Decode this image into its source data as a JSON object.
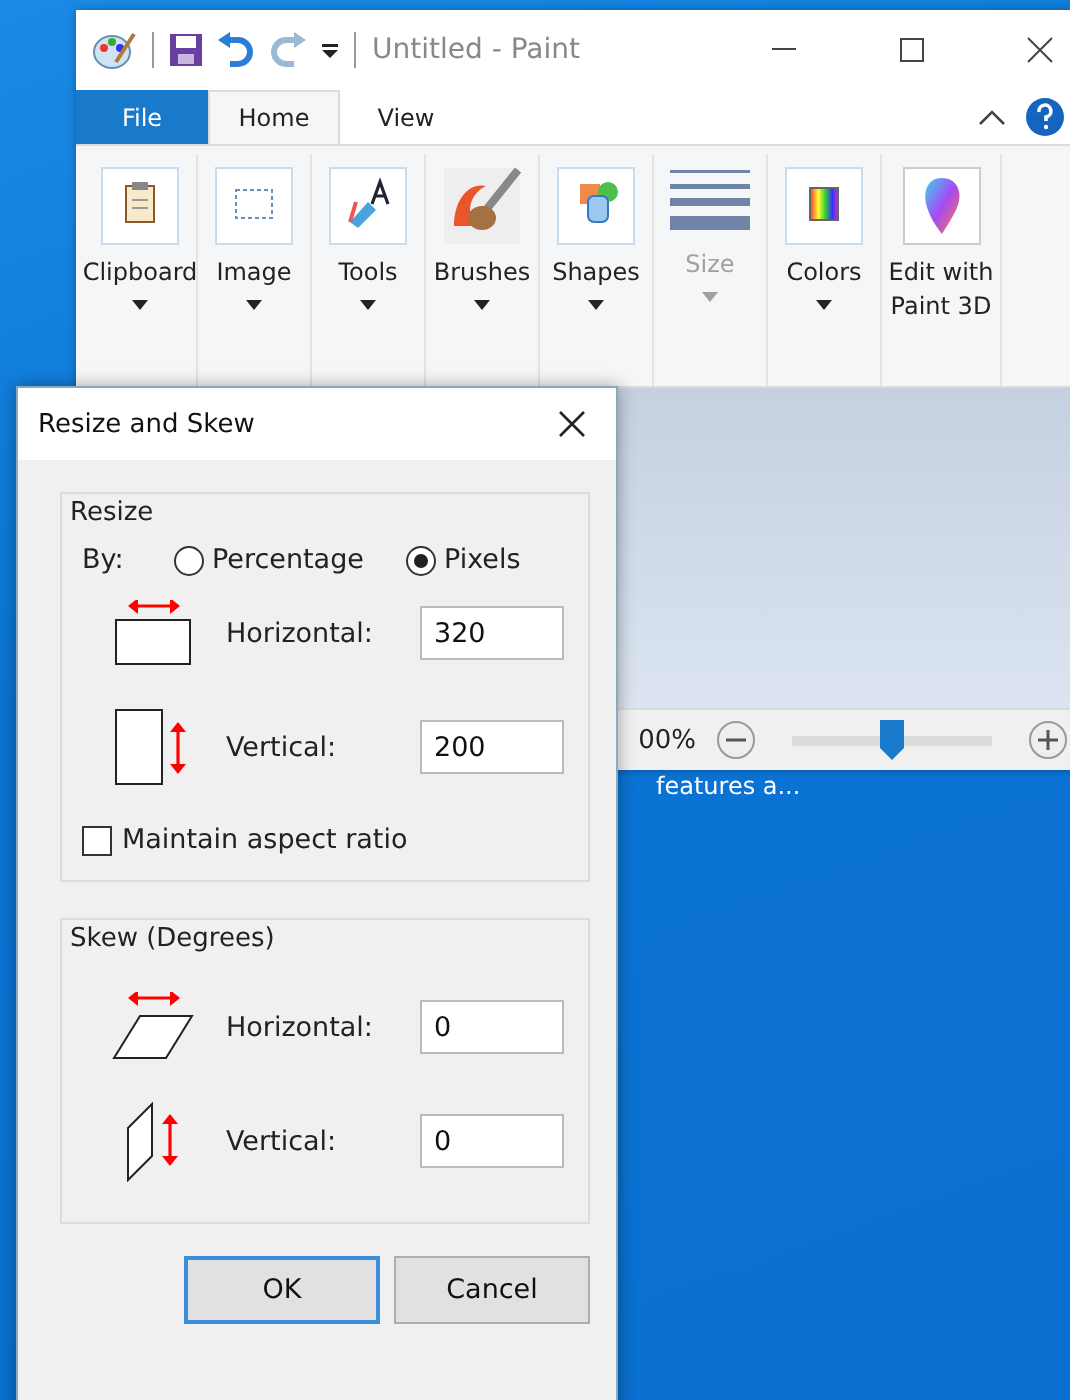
{
  "desktop": {
    "icon_label": "features a..."
  },
  "paint_window": {
    "title": "Untitled - Paint",
    "tabs": [
      {
        "label": "File",
        "kind": "file",
        "selected": false
      },
      {
        "label": "Home",
        "kind": "tab",
        "selected": true
      },
      {
        "label": "View",
        "kind": "tab",
        "selected": false
      }
    ],
    "ribbon_groups": [
      {
        "label": "Clipboard",
        "kind": "clipboard",
        "dropdown": true,
        "disabled": false
      },
      {
        "label": "Image",
        "kind": "image",
        "dropdown": true,
        "disabled": false
      },
      {
        "label": "Tools",
        "kind": "tools",
        "dropdown": true,
        "disabled": false
      },
      {
        "label": "Brushes",
        "kind": "brushes",
        "dropdown": true,
        "disabled": false
      },
      {
        "label": "Shapes",
        "kind": "shapes",
        "dropdown": true,
        "disabled": false
      },
      {
        "label": "Size",
        "kind": "size",
        "dropdown": true,
        "disabled": true
      },
      {
        "label": "Colors",
        "kind": "colors",
        "dropdown": true,
        "disabled": false
      },
      {
        "label": "Edit with Paint 3D",
        "kind": "paint3d",
        "dropdown": false,
        "disabled": false
      }
    ],
    "status_bar": {
      "zoom": "00%",
      "zoom_slider": {
        "level": 0.5
      }
    }
  },
  "dialog": {
    "title": "Resize and Skew",
    "resize": {
      "title": "Resize",
      "by_label": "By:",
      "units": [
        {
          "label": "Percentage",
          "selected": false
        },
        {
          "label": "Pixels",
          "selected": true
        }
      ],
      "fields": [
        {
          "label": "Horizontal:",
          "value": "320",
          "kind": "horizontal"
        },
        {
          "label": "Vertical:",
          "value": "200",
          "kind": "vertical"
        }
      ],
      "maintain_aspect_ratio": {
        "label": "Maintain aspect ratio",
        "checked": false
      }
    },
    "skew": {
      "title": "Skew (Degrees)",
      "fields": [
        {
          "label": "Horizontal:",
          "value": "0",
          "kind": "skew-horizontal"
        },
        {
          "label": "Vertical:",
          "value": "0",
          "kind": "skew-vertical"
        }
      ]
    },
    "buttons": [
      {
        "label": "OK",
        "default": true
      },
      {
        "label": "Cancel",
        "default": false
      }
    ]
  }
}
